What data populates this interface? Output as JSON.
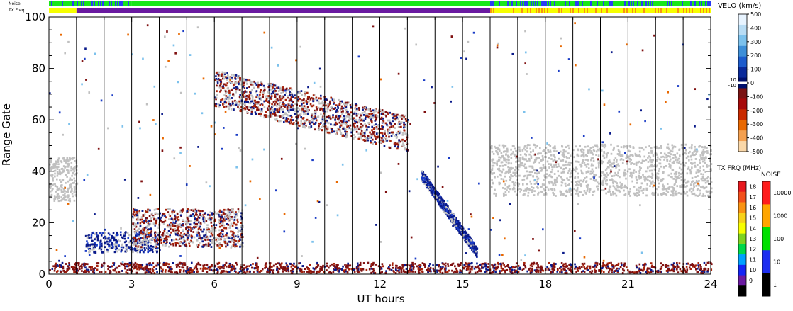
{
  "chart_data": {
    "type": "heatmap",
    "title": "",
    "xlabel": "UT hours",
    "ylabel": "Range Gate",
    "xlim": [
      0,
      24
    ],
    "ylim": [
      0,
      100
    ],
    "x_ticks": [
      "0",
      "3",
      "6",
      "9",
      "12",
      "15",
      "18",
      "21",
      "24"
    ],
    "y_ticks": [
      "0",
      "20",
      "40",
      "60",
      "80",
      "100"
    ],
    "scan_boundaries_ut": [
      1,
      2,
      3,
      4,
      5,
      6,
      7,
      8,
      9,
      10,
      11,
      12,
      13,
      14,
      15,
      16,
      17,
      18,
      19,
      20,
      21,
      22,
      23
    ],
    "top_bars": {
      "noise_label": "Noise",
      "txfreq_label": "TX Freq",
      "noise_segments": [
        {
          "from": 0,
          "to": 3,
          "level": "green-blue"
        },
        {
          "from": 3,
          "to": 8,
          "level": "green"
        },
        {
          "from": 8,
          "to": 16,
          "level": "green"
        },
        {
          "from": 16,
          "to": 24,
          "level": "blue-green"
        }
      ],
      "txfreq_segments": [
        {
          "from": 0,
          "to": 1,
          "mhz": "yellow"
        },
        {
          "from": 1,
          "to": 16,
          "mhz": "purple"
        },
        {
          "from": 16,
          "to": 24,
          "mhz": "yellow-orange"
        }
      ]
    },
    "features": [
      {
        "name": "ground scatter band (morning)",
        "x": [
          0,
          1
        ],
        "y": [
          28,
          45
        ],
        "kind": "ground"
      },
      {
        "name": "ground scatter band (day)",
        "x": [
          16,
          24
        ],
        "y": [
          30,
          50
        ],
        "kind": "ground"
      },
      {
        "name": "echo band gates 55-75",
        "x": [
          6,
          13
        ],
        "y": [
          50,
          75
        ],
        "kind": "mixed"
      },
      {
        "name": "low velocity band gates 10-15",
        "x": [
          1.3,
          4
        ],
        "y": [
          8,
          16
        ],
        "kind": "negative"
      },
      {
        "name": "echoes gates 10-25",
        "x": [
          3,
          7
        ],
        "y": [
          10,
          25
        ],
        "kind": "mixed"
      },
      {
        "name": "near range scatter",
        "x": [
          0,
          24
        ],
        "y": [
          0,
          4
        ],
        "kind": "positive"
      },
      {
        "name": "descending trace",
        "x": [
          13.5,
          15.5
        ],
        "y": [
          8,
          38
        ],
        "kind": "negative"
      }
    ],
    "velocity_legend": {
      "title": "VELO (km/s)",
      "ticks": [
        "500",
        "400",
        "300",
        "200",
        "100",
        "0",
        "-100",
        "-200",
        "-300",
        "-400",
        "-500"
      ],
      "side_labels": [
        "10",
        "-10"
      ],
      "colors": [
        "#e8f4ff",
        "#b8dcf4",
        "#7cc1ec",
        "#3e8fd8",
        "#1d5ccd",
        "#0a2a9a",
        "#00106e",
        "#7a1414",
        "#a60a0a",
        "#c92a00",
        "#e86800",
        "#f3a050",
        "#f9d7a8"
      ]
    },
    "txfreq_legend": {
      "title": "TX FRQ (MHz)",
      "ticks": [
        "18",
        "17",
        "16",
        "15",
        "14",
        "13",
        "12",
        "11",
        "10",
        "9"
      ],
      "colors": [
        "#e8191e",
        "#f2501b",
        "#f99313",
        "#f7d21a",
        "#f7ff00",
        "#7ed321",
        "#00d84a",
        "#00a0ff",
        "#1424f5",
        "#6a1aa1",
        "#000000"
      ]
    },
    "noise_legend": {
      "title": "NOISE",
      "ticks": [
        "10000",
        "1000",
        "100",
        "10",
        "1"
      ],
      "colors": [
        "#ff1c1c",
        "#ffa500",
        "#00e000",
        "#1d2ef0",
        "#000000"
      ]
    },
    "colors": {
      "ground": "#c0c0c0",
      "positive_dark": "#7f1010",
      "positive_mid": "#a8230a",
      "negative_dark": "#0a1a8a",
      "negative_mid": "#1a3cc6",
      "grid": "#000000"
    }
  }
}
